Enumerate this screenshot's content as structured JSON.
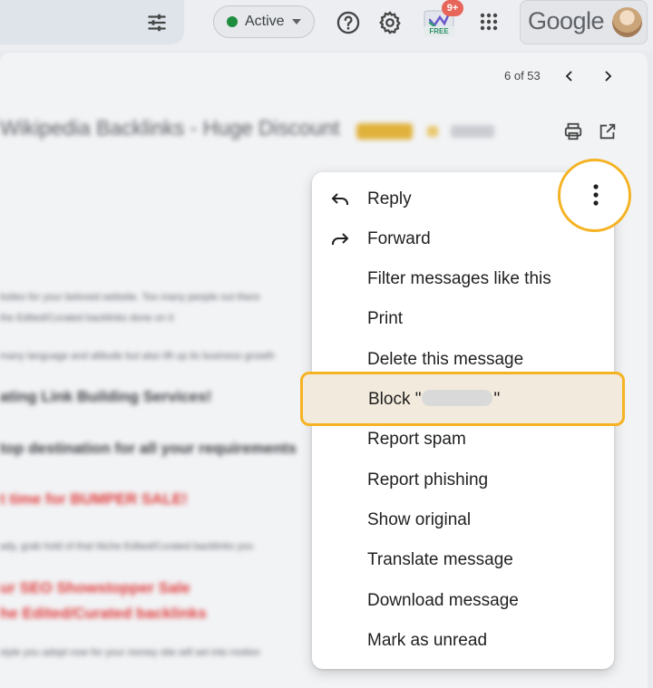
{
  "topbar": {
    "status_label": "Active",
    "status_color": "#1e8e3e",
    "extension_badge": "9+",
    "extension_tag": "FREE",
    "brand": "Google",
    "icons": [
      "filter-icon",
      "help-icon",
      "settings-icon",
      "extension-icon",
      "apps-icon",
      "avatar"
    ]
  },
  "mail": {
    "pager": "6 of 53",
    "subject": "Wikipedia Backlinks - Huge Discount",
    "body": {
      "line1": "ksites for your beloved website. Too many people out there",
      "line2": "the Edited/Curated backlinks done on it",
      "line3": "many language and altitude but also lift up its business growth",
      "head1": "ating Link Building Services!",
      "head2": "top destination for all your requirements",
      "red1": "t time for BUMPER SALE!",
      "line4": "ady, grab hold of that Niche Edited/Curated backlinks you",
      "red2": "ur SEO Showstopper Sale",
      "red3": "he Edited/Curated backlinks",
      "line5": "style you adopt now for your money site will set into motion"
    }
  },
  "menu": {
    "items": [
      {
        "label": "Reply",
        "icon": "reply-icon"
      },
      {
        "label": "Forward",
        "icon": "forward-icon"
      },
      {
        "label": "Filter messages like this"
      },
      {
        "label": "Print"
      },
      {
        "label": "Delete this message"
      },
      {
        "label_prefix": "Block \"",
        "label_suffix": "\""
      },
      {
        "label": "Report spam"
      },
      {
        "label": "Report phishing"
      },
      {
        "label": "Show original"
      },
      {
        "label": "Translate message"
      },
      {
        "label": "Download message"
      },
      {
        "label": "Mark as unread"
      }
    ]
  },
  "colors": {
    "highlight_ring": "#f5b323",
    "highlight_fill": "#f2eadc"
  }
}
